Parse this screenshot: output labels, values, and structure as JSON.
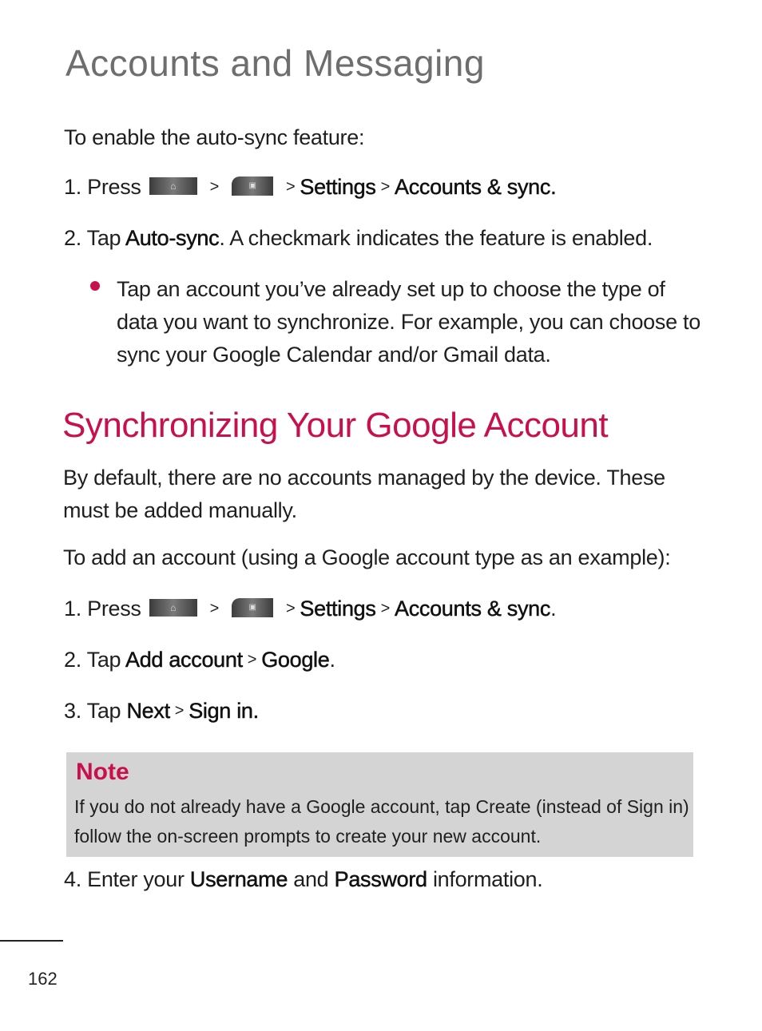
{
  "header": {
    "title": "Accounts and Messaging"
  },
  "autosync": {
    "heading": "To enable the auto-sync feature:",
    "step1": {
      "num": "1. Press",
      "home_icon": "home-key-icon",
      "sep1": ">",
      "menu_icon": "menu-key-icon",
      "sep2": ">",
      "settings": "Settings",
      "sep3": ">",
      "accounts": "Accounts & sync."
    },
    "step2": {
      "num": "2.  Tap",
      "auto": "Auto-sync",
      "rest": ". A checkmark indicates the feature is enabled."
    },
    "bullet": "Tap an account you’ve already set up to choose the type of data you want to synchronize. For example, you can choose to sync your Google Calendar and/or Gmail data."
  },
  "google": {
    "title": "Synchronizing Your Google Account",
    "intro": "By default, there are no accounts managed by the device. These must be added manually.",
    "lead": "To add an account (using a Google account type as an example):",
    "step1": {
      "num": "1. Press",
      "sep1": ">",
      "sep2": ">",
      "settings": "Settings",
      "sep3": ">",
      "accounts": "Accounts & sync",
      "end": "."
    },
    "step2": {
      "num": "2. Tap",
      "add": "Add account",
      "sep": ">",
      "google": "Google",
      "end": "."
    },
    "step3": {
      "num": "3. Tap",
      "next": "Next",
      "sep": ">",
      "signin": "Sign in."
    },
    "note": {
      "title": "Note",
      "text": "If you do not already have a Google account, tap Create (instead of Sign in) follow the on-screen prompts to create your new account."
    },
    "step4": {
      "num": "4. Enter your",
      "user": "Username",
      "and": "and",
      "pass": "Password",
      "end": "information."
    }
  },
  "footer": {
    "page": "162"
  },
  "colors": {
    "accent": "#c8104d",
    "note_bg": "#d4d4d4",
    "title_gray": "#6e6e6e"
  }
}
